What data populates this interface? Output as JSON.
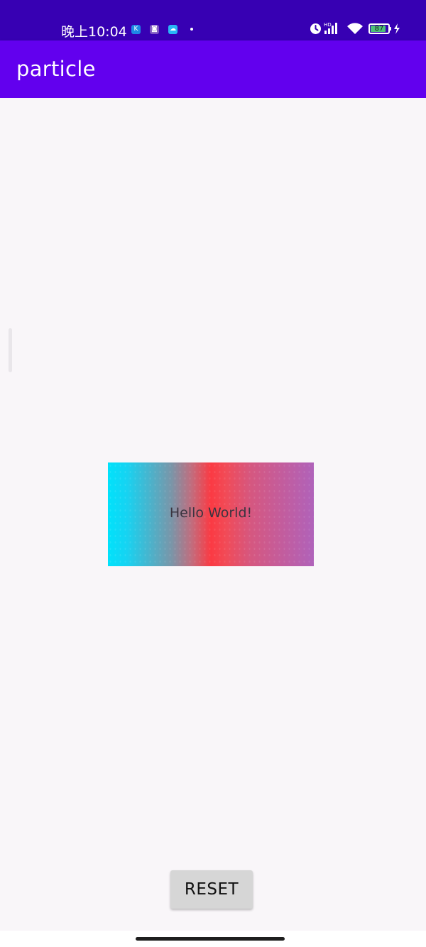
{
  "status_bar": {
    "time": "晚上10:04",
    "notifications": [
      {
        "icon": "k-app-icon",
        "glyph": "K",
        "color": "#1e88e5"
      },
      {
        "icon": "camera-app-icon",
        "glyph": "◙",
        "color": "#7e57c2"
      },
      {
        "icon": "cloud-app-icon",
        "glyph": "☁",
        "color": "#29b6f6"
      }
    ],
    "battery_level": "87",
    "battery_fraction": 0.87,
    "battery_color": "#4dc07a",
    "network_label": "HD"
  },
  "app_bar": {
    "title": "particle",
    "color": "#6200ee"
  },
  "main": {
    "hello_text": "Hello World!",
    "gradient_colors": [
      "#00e2fb",
      "#7b95a8",
      "#fb3a43",
      "#d6577f",
      "#b062ba"
    ]
  },
  "controls": {
    "reset_label": "RESET"
  }
}
